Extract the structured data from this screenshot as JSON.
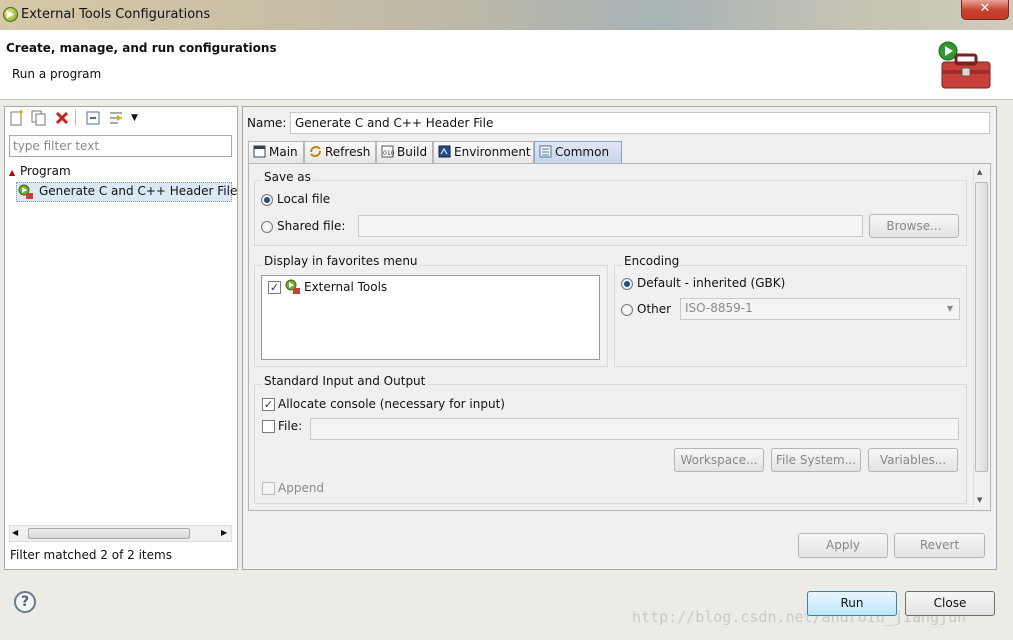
{
  "window": {
    "title": "External Tools Configurations",
    "close_label": "✕"
  },
  "header": {
    "title": "Create, manage, and run configurations",
    "subtitle": "Run a program"
  },
  "left": {
    "filter_placeholder": "type filter text",
    "tree": {
      "category": "Program",
      "item": "Generate C and C++ Header File"
    },
    "status": "Filter matched 2 of 2 items"
  },
  "right": {
    "name_label": "Name:",
    "name_value": "Generate C and C++ Header File",
    "tabs": [
      "Main",
      "Refresh",
      "Build",
      "Environment",
      "Common"
    ],
    "save_as": {
      "title": "Save as",
      "local_file": "Local file",
      "shared_file": "Shared file:",
      "browse": "Browse..."
    },
    "favorites": {
      "title": "Display in favorites menu",
      "item": "External Tools"
    },
    "encoding": {
      "title": "Encoding",
      "default": "Default - inherited (GBK)",
      "other": "Other",
      "other_value": "ISO-8859-1"
    },
    "stdio": {
      "title": "Standard Input and Output",
      "allocate_console": "Allocate console (necessary for input)",
      "file": "File:",
      "workspace": "Workspace...",
      "file_system": "File System...",
      "variables": "Variables...",
      "append": "Append"
    },
    "apply": "Apply",
    "revert": "Revert"
  },
  "footer": {
    "run": "Run",
    "close": "Close",
    "help": "?"
  },
  "watermark": "http://blog.csdn.net/android_jiangjun"
}
